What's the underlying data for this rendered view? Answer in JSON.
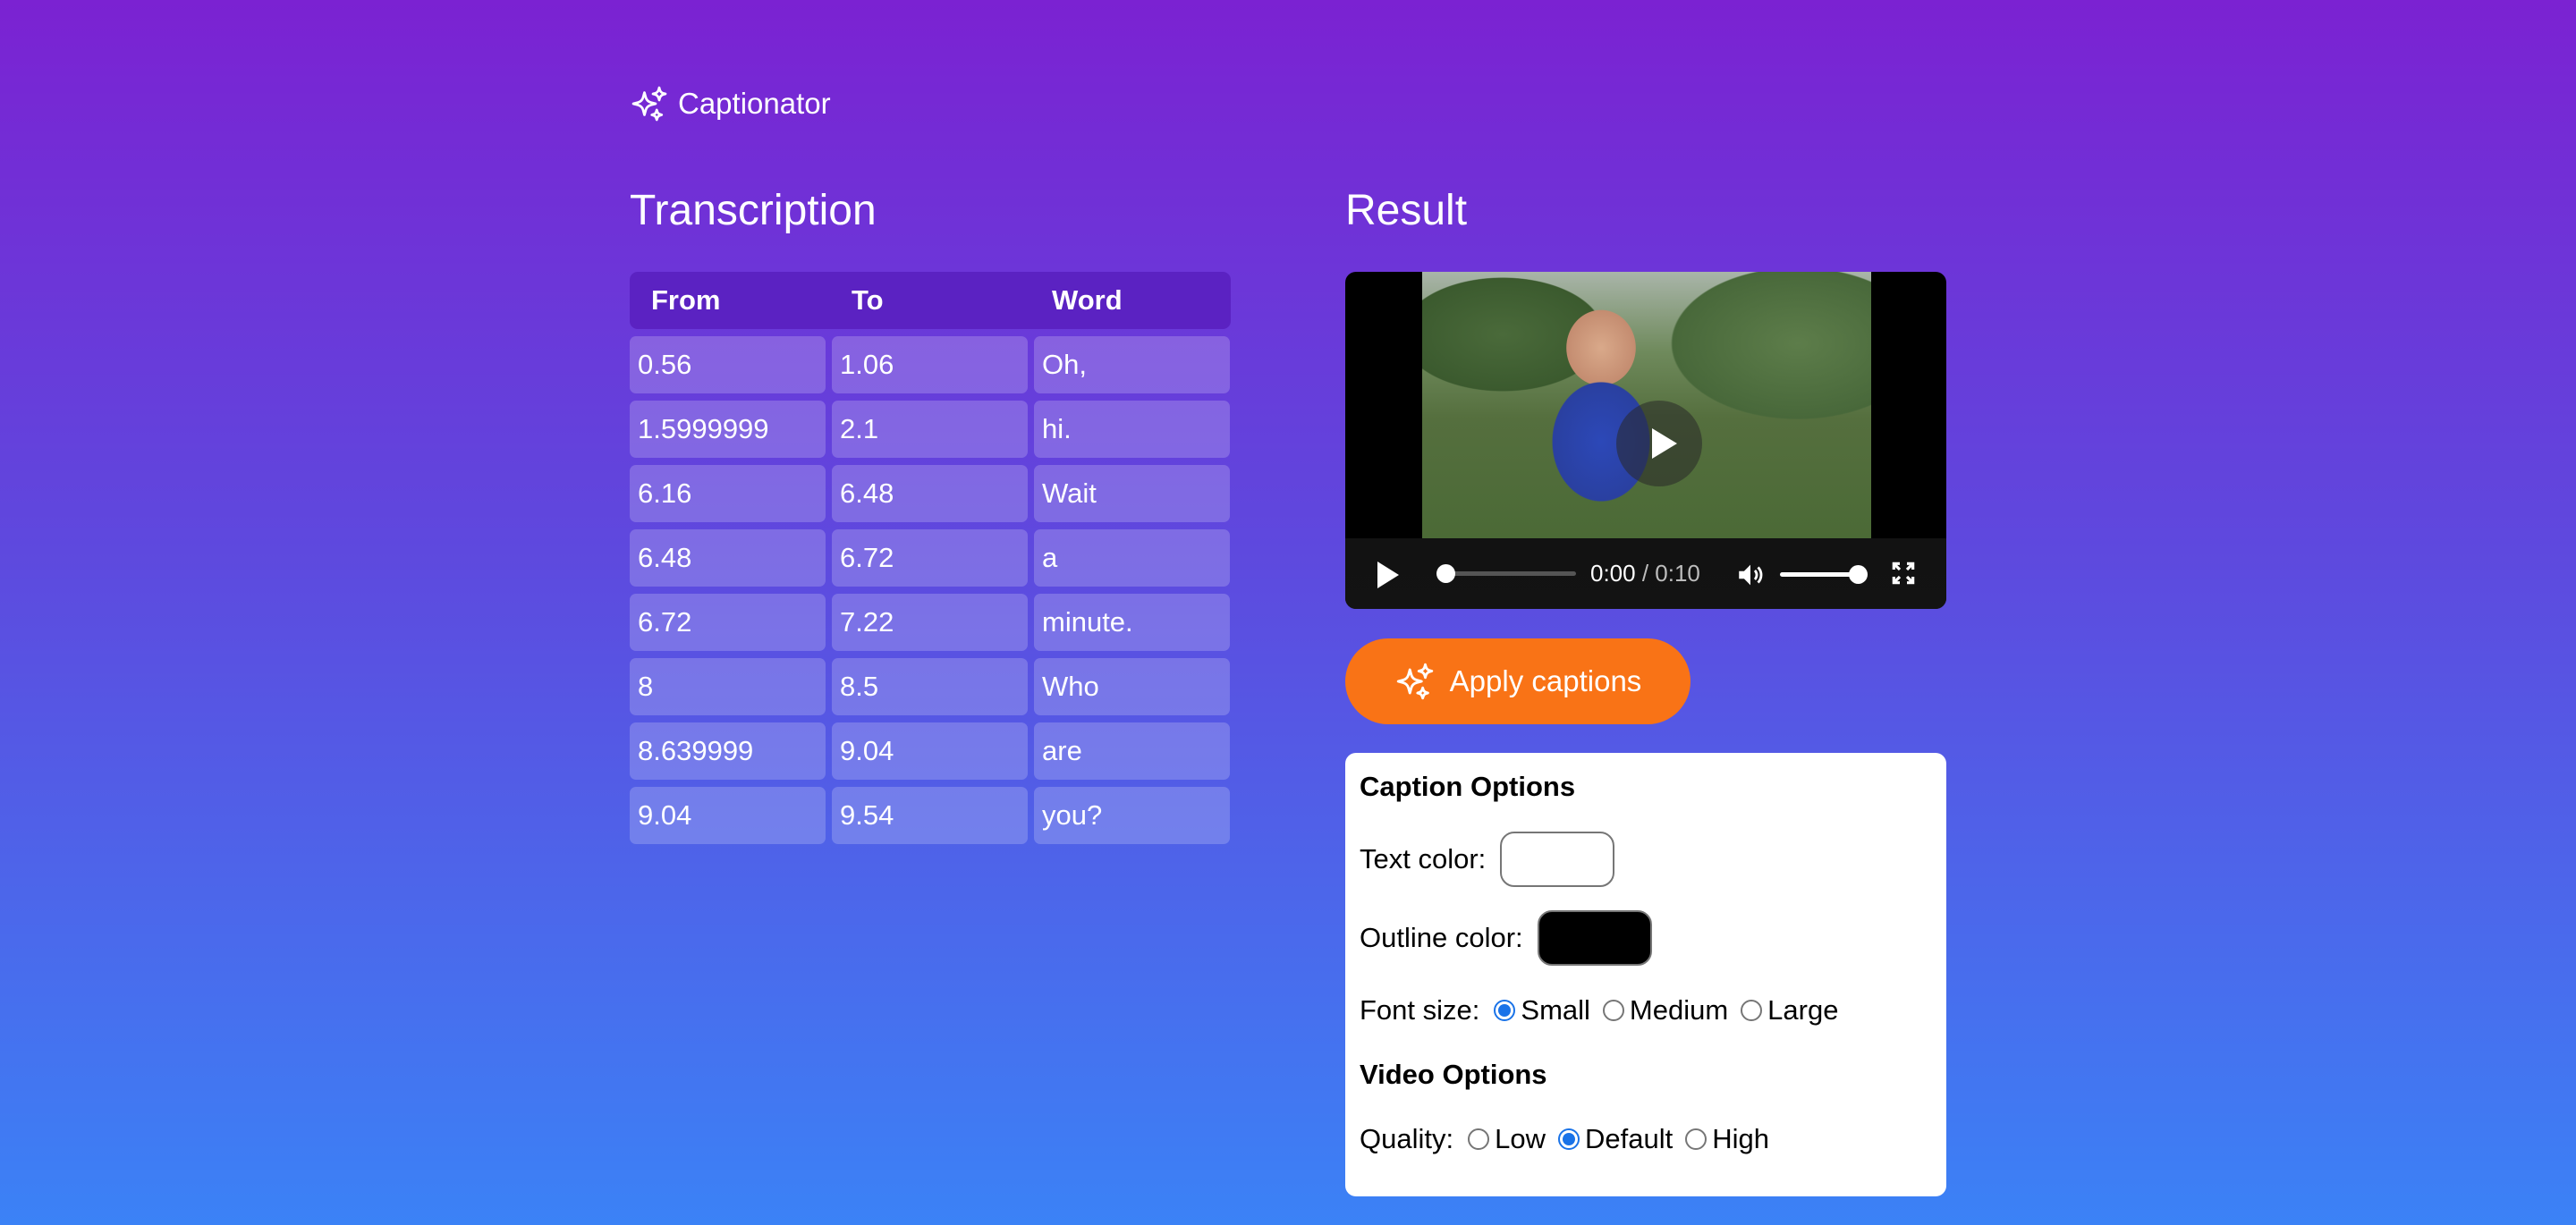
{
  "brand": {
    "name": "Captionator",
    "icon": "sparkles-icon"
  },
  "transcription": {
    "title": "Transcription",
    "columns": [
      "From",
      "To",
      "Word"
    ],
    "rows": [
      {
        "from": "0.56",
        "to": "1.06",
        "word": "Oh,"
      },
      {
        "from": "1.5999999",
        "to": "2.1",
        "word": "hi."
      },
      {
        "from": "6.16",
        "to": "6.48",
        "word": "Wait"
      },
      {
        "from": "6.48",
        "to": "6.72",
        "word": "a"
      },
      {
        "from": "6.72",
        "to": "7.22",
        "word": "minute."
      },
      {
        "from": "8",
        "to": "8.5",
        "word": "Who"
      },
      {
        "from": "8.639999",
        "to": "9.04",
        "word": "are"
      },
      {
        "from": "9.04",
        "to": "9.54",
        "word": "you?"
      }
    ]
  },
  "result": {
    "title": "Result",
    "player": {
      "current_time": "0:00",
      "duration": "/ 0:10",
      "progress": 0,
      "volume": 1.0
    }
  },
  "apply_button": {
    "label": "Apply captions",
    "color": "#f97316"
  },
  "options": {
    "caption_heading": "Caption Options",
    "text_color_label": "Text color:",
    "text_color_value": "#ffffff",
    "outline_color_label": "Outline color:",
    "outline_color_value": "#000000",
    "font_size_label": "Font size:",
    "font_sizes": [
      {
        "label": "Small",
        "selected": true
      },
      {
        "label": "Medium",
        "selected": false
      },
      {
        "label": "Large",
        "selected": false
      }
    ],
    "video_heading": "Video Options",
    "quality_label": "Quality:",
    "qualities": [
      {
        "label": "Low",
        "selected": false
      },
      {
        "label": "Default",
        "selected": true
      },
      {
        "label": "High",
        "selected": false
      }
    ]
  },
  "colors": {
    "bg_top": "#7b22d2",
    "bg_bottom": "#3b82f6",
    "table_header": "#5b22c2",
    "accent": "#f97316",
    "radio_selected": "#1a73e8"
  }
}
